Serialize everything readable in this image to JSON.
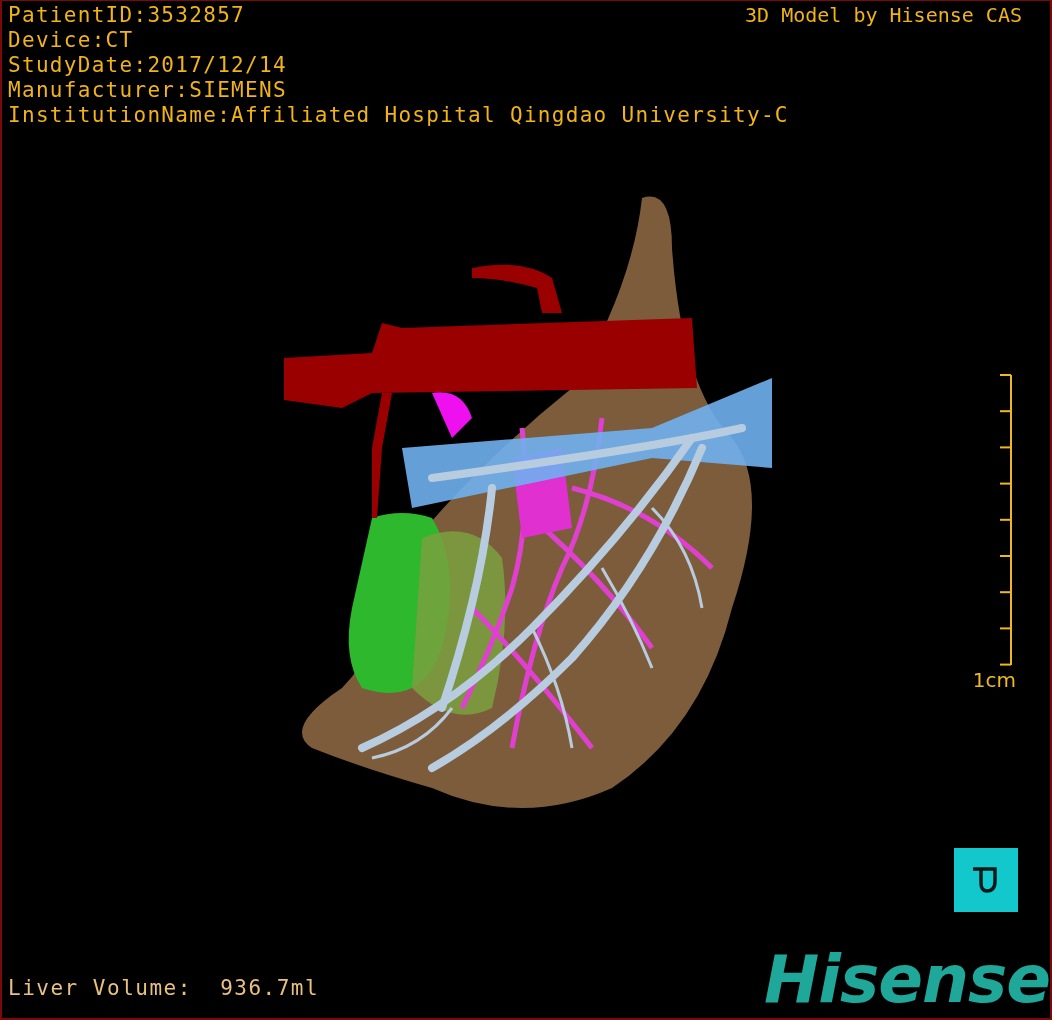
{
  "header_lines": [
    "PatientID:3532857",
    "Device:CT",
    "StudyDate:2017/12/14",
    "Manufacturer:SIEMENS",
    "InstitutionName:Affiliated Hospital Qingdao University-C"
  ],
  "model_credit": "3D Model by Hisense CAS",
  "scale_bar": {
    "label": "1cm"
  },
  "liver_volume": "Liver Volume:  936.7ml",
  "logo": "Hisense"
}
